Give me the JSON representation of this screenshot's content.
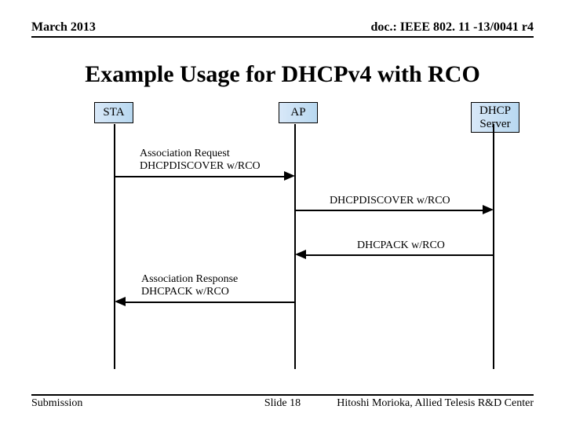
{
  "header": {
    "left": "March 2013",
    "right": "doc.: IEEE 802. 11 -13/0041 r4"
  },
  "title": "Example Usage for DHCPv4 with RCO",
  "actors": {
    "sta": "STA",
    "ap": "AP",
    "dhcp_line1": "DHCP",
    "dhcp_line2": "Server"
  },
  "messages": {
    "m1_line1": "Association Request",
    "m1_line2": "DHCPDISCOVER w/RCO",
    "m2": "DHCPDISCOVER w/RCO",
    "m3": "DHCPACK w/RCO",
    "m4_line1": "Association Response",
    "m4_line2": "DHCPACK w/RCO"
  },
  "footer": {
    "left": "Submission",
    "center": "Slide 18",
    "right": "Hitoshi Morioka, Allied Telesis R&D Center"
  }
}
